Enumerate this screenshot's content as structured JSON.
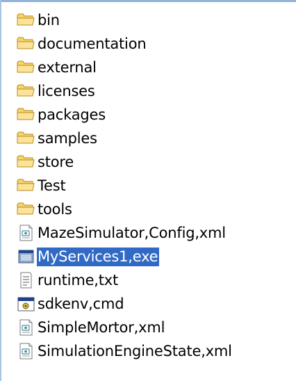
{
  "explorer": {
    "items": [
      {
        "label": "bin",
        "icon": "folder-icon",
        "kind": "folder"
      },
      {
        "label": "documentation",
        "icon": "folder-icon",
        "kind": "folder"
      },
      {
        "label": "external",
        "icon": "folder-icon",
        "kind": "folder"
      },
      {
        "label": "licenses",
        "icon": "folder-icon",
        "kind": "folder"
      },
      {
        "label": "packages",
        "icon": "folder-icon",
        "kind": "folder"
      },
      {
        "label": "samples",
        "icon": "folder-icon",
        "kind": "folder"
      },
      {
        "label": "store",
        "icon": "folder-icon",
        "kind": "folder"
      },
      {
        "label": "Test",
        "icon": "folder-icon",
        "kind": "folder"
      },
      {
        "label": "tools",
        "icon": "folder-icon",
        "kind": "folder"
      },
      {
        "label": "MazeSimulator,Config,xml",
        "icon": "xml-file-icon",
        "kind": "xml"
      },
      {
        "label": "MyServices1,exe",
        "icon": "exe-file-icon",
        "kind": "exe",
        "selected": true
      },
      {
        "label": "runtime,txt",
        "icon": "text-file-icon",
        "kind": "txt"
      },
      {
        "label": "sdkenv,cmd",
        "icon": "cmd-file-icon",
        "kind": "cmd"
      },
      {
        "label": "SimpleMortor,xml",
        "icon": "xml-file-icon",
        "kind": "xml"
      },
      {
        "label": "SimulationEngineState,xml",
        "icon": "xml-file-icon",
        "kind": "xml"
      }
    ],
    "colors": {
      "folder_fill": "#f7d36b",
      "folder_stroke": "#b98a1e",
      "selection": "#316ac5"
    }
  }
}
